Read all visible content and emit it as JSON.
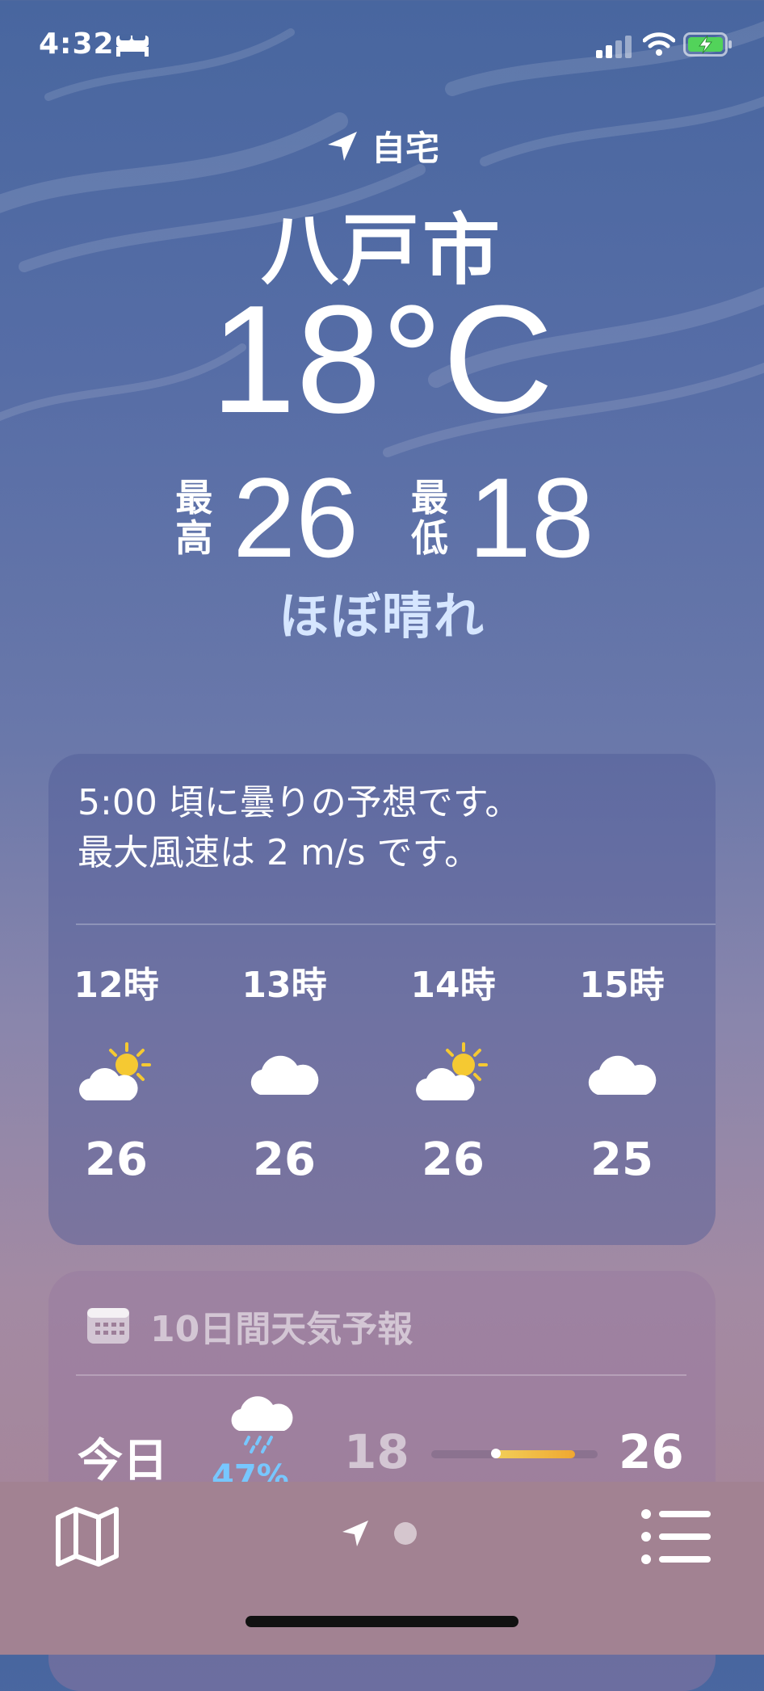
{
  "status_bar": {
    "time": "4:32"
  },
  "header": {
    "location_label": "自宅",
    "city": "八戸市",
    "current_temp": "18°C",
    "high_label": [
      "最",
      "高"
    ],
    "high_value": "26",
    "low_label": [
      "最",
      "低"
    ],
    "low_value": "18",
    "condition": "ほぼ晴れ"
  },
  "hourly": {
    "summary_line1": "5:00 頃に曇りの予想です。",
    "summary_line2": "最大風速は 2 m/s です。",
    "hours": [
      {
        "label": "12時",
        "icon": "partly-sunny-icon",
        "temp": "26"
      },
      {
        "label": "13時",
        "icon": "cloud-icon",
        "temp": "26"
      },
      {
        "label": "14時",
        "icon": "partly-sunny-icon",
        "temp": "26"
      },
      {
        "label": "15時",
        "icon": "cloud-icon",
        "temp": "25"
      }
    ]
  },
  "ten_day": {
    "title": "10日間天気予報",
    "days": [
      {
        "label": "今日",
        "icon": "cloud-rain-icon",
        "precip": "47%",
        "low": "18",
        "high": "26",
        "range_fill": 0.5
      }
    ]
  },
  "toolbar": {
    "map_icon": "map-icon",
    "list_icon": "list-icon"
  },
  "colors": {
    "condition_text": "#d6e6ff",
    "precip": "#77c7ff",
    "temp_bar_start": "#f2d05a",
    "temp_bar_end": "#f0a830",
    "toolbar_bg": "#a28292"
  }
}
